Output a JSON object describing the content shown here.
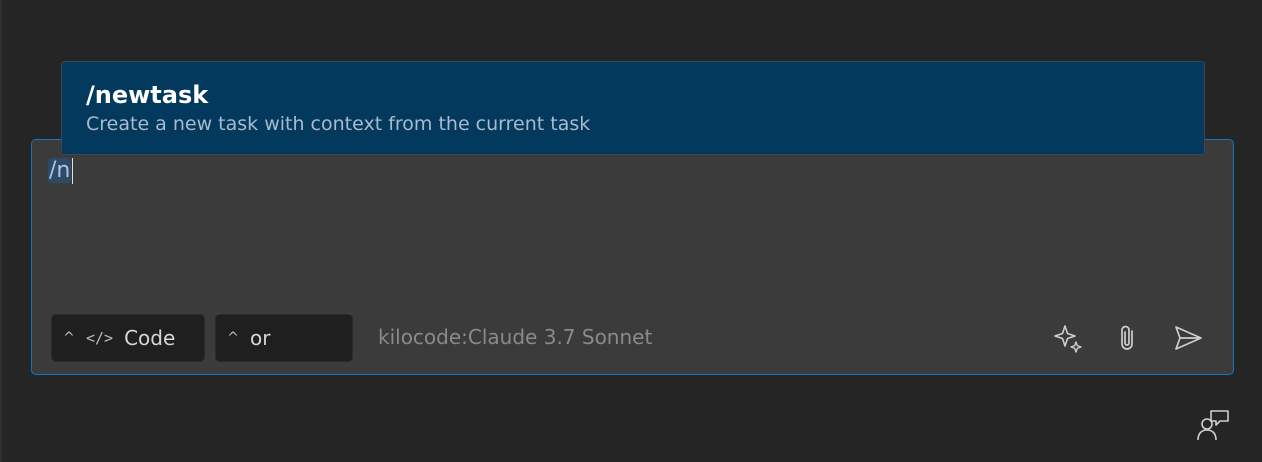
{
  "input": {
    "prefix": "/n"
  },
  "popup": {
    "title": "/newtask",
    "description": "Create a new task with context from the current task"
  },
  "toolbar": {
    "mode_label": "Code",
    "mode_chevron": "^",
    "mode_icon": "</>",
    "model_chevron": "^",
    "model_label": "or",
    "model_status": "kilocode:Claude 3.7 Sonnet"
  },
  "icons": {
    "enhance": "sparkles-icon",
    "attach": "paperclip-icon",
    "send": "send-icon",
    "corner": "account-feedback-icon"
  },
  "colors": {
    "accent": "#0e78c7",
    "popup_bg": "#04395e",
    "input_bg": "#3b3b3b",
    "page_bg": "#252526"
  }
}
